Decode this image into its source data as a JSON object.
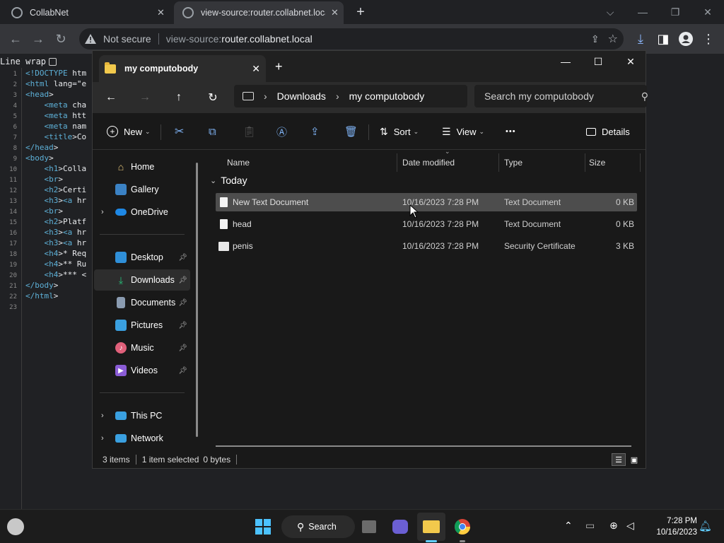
{
  "browser": {
    "tabs": [
      {
        "title": "CollabNet"
      },
      {
        "title": "view-source:router.collabnet.loca"
      }
    ],
    "new_tab_label": "+",
    "omnibox": {
      "security_label": "Not secure",
      "url_prefix": "view-source:",
      "url_host": "router.collabnet.local"
    }
  },
  "viewsource": {
    "line_wrap_label": "Line wrap",
    "line_numbers": [
      "1",
      "2",
      "3",
      "4",
      "5",
      "6",
      "7",
      "8",
      "9",
      "10",
      "11",
      "12",
      "13",
      "14",
      "15",
      "16",
      "17",
      "18",
      "19",
      "20",
      "21",
      "22",
      "23"
    ],
    "lines": [
      "<!DOCTYPE htm",
      "<html lang=\"e",
      "<head>",
      "    <meta cha",
      "    <meta htt",
      "    <meta nam",
      "    <title>Co",
      "</head>",
      "<body>",
      "    <h1>Colla",
      "    <br>",
      "    <h2>Certi",
      "    <h3><a hr",
      "    <br>",
      "    <h2>Platf",
      "    <h3><a hr",
      "    <h3><a hr",
      "    <h4>* Req",
      "    <h4>** Ru",
      "    <h4>*** <",
      "</body>",
      "</html>",
      ""
    ]
  },
  "explorer": {
    "tab_title": "my computobody",
    "breadcrumb": [
      "Downloads",
      "my computobody"
    ],
    "search_placeholder": "Search my computobody",
    "commands": {
      "new": "New",
      "sort": "Sort",
      "view": "View",
      "more": "•••",
      "details": "Details"
    },
    "sidebar": {
      "items": [
        {
          "label": "Home",
          "icon": "home-icon"
        },
        {
          "label": "Gallery",
          "icon": "gallery-icon"
        },
        {
          "label": "OneDrive",
          "icon": "cloud-icon"
        },
        {
          "label": "Desktop",
          "icon": "desktop-icon"
        },
        {
          "label": "Downloads",
          "icon": "download-icon"
        },
        {
          "label": "Documents",
          "icon": "documents-icon"
        },
        {
          "label": "Pictures",
          "icon": "pictures-icon"
        },
        {
          "label": "Music",
          "icon": "music-icon"
        },
        {
          "label": "Videos",
          "icon": "videos-icon"
        },
        {
          "label": "This PC",
          "icon": "computer-icon"
        },
        {
          "label": "Network",
          "icon": "network-icon"
        }
      ]
    },
    "columns": {
      "name": "Name",
      "date": "Date modified",
      "type": "Type",
      "size": "Size"
    },
    "group_label": "Today",
    "files": [
      {
        "name": "New Text Document",
        "date": "10/16/2023 7:28 PM",
        "type": "Text Document",
        "size": "0 KB",
        "selected": true
      },
      {
        "name": "head",
        "date": "10/16/2023 7:28 PM",
        "type": "Text Document",
        "size": "0 KB",
        "selected": false
      },
      {
        "name": "penis",
        "date": "10/16/2023 7:28 PM",
        "type": "Security Certificate",
        "size": "3 KB",
        "selected": false
      }
    ],
    "status": {
      "item_count": "3 items",
      "selection": "1 item selected",
      "size": "0 bytes"
    }
  },
  "taskbar": {
    "search_label": "Search",
    "time": "7:28 PM",
    "date": "10/16/2023"
  },
  "colors": {
    "accent": "#0078d4",
    "folder": "#f2c94c",
    "chrome_bg": "#202124"
  }
}
